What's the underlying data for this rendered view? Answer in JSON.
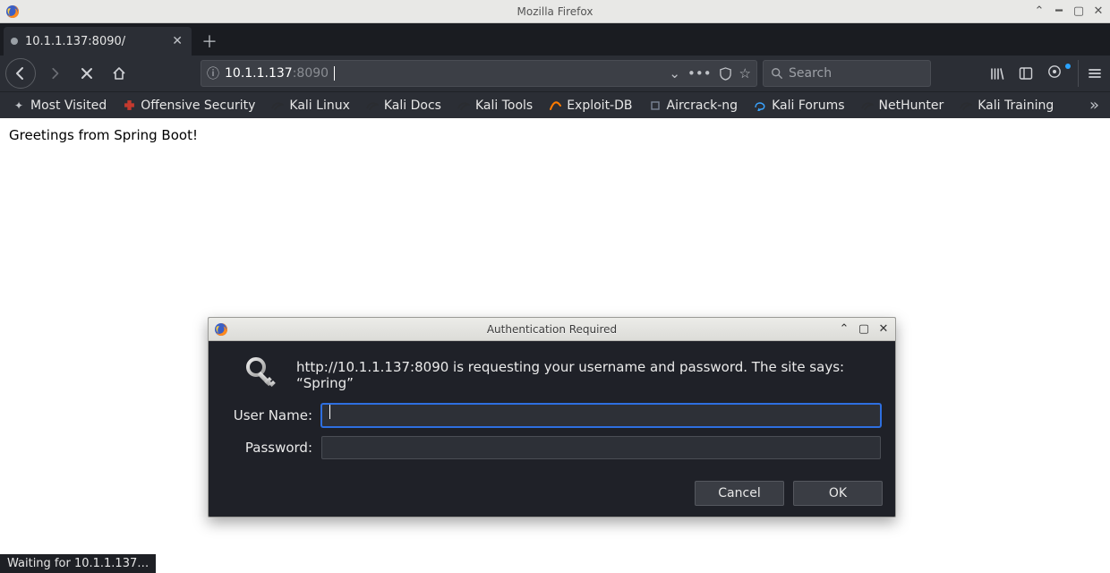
{
  "window": {
    "title": "Mozilla Firefox"
  },
  "tab": {
    "title": "10.1.1.137:8090/"
  },
  "url": {
    "host": "10.1.1.137",
    "port": ":8090"
  },
  "search": {
    "placeholder": "Search"
  },
  "bookmarks": {
    "items": [
      {
        "label": "Most Visited",
        "icon": "star"
      },
      {
        "label": "Offensive Security",
        "icon": "offensive"
      },
      {
        "label": "Kali Linux",
        "icon": "kali"
      },
      {
        "label": "Kali Docs",
        "icon": "kali"
      },
      {
        "label": "Kali Tools",
        "icon": "kali"
      },
      {
        "label": "Exploit-DB",
        "icon": "exploit"
      },
      {
        "label": "Aircrack-ng",
        "icon": "aircrack"
      },
      {
        "label": "Kali Forums",
        "icon": "forums"
      },
      {
        "label": "NetHunter",
        "icon": "kali"
      },
      {
        "label": "Kali Training",
        "icon": "kali"
      }
    ]
  },
  "page": {
    "greeting": "Greetings from Spring Boot!"
  },
  "status": {
    "text": "Waiting for 10.1.1.137…"
  },
  "dialog": {
    "title": "Authentication Required",
    "message": "http://10.1.1.137:8090 is requesting your username and password. The site says: “Spring”",
    "username_label": "User Name:",
    "password_label": "Password:",
    "username_value": "",
    "password_value": "",
    "cancel_label": "Cancel",
    "ok_label": "OK"
  }
}
